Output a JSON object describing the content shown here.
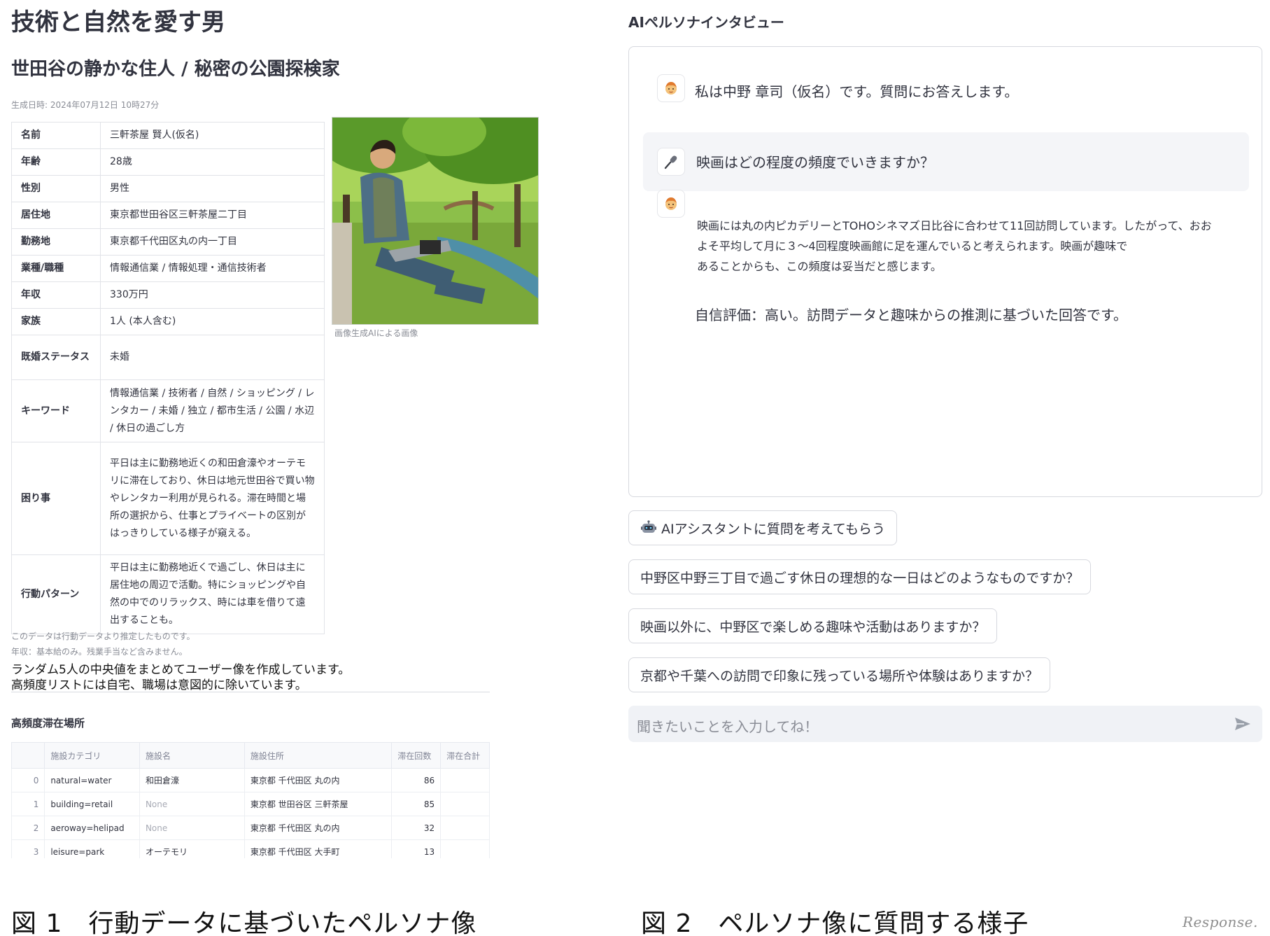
{
  "persona": {
    "title": "技術と自然を愛す男",
    "subtitle": "世田谷の静かな住人 / 秘密の公園探検家",
    "generated_at": "生成日時: 2024年07月12日 10時27分",
    "profile_rows": [
      {
        "key": "名前",
        "value": "三軒茶屋 賢人(仮名)"
      },
      {
        "key": "年齢",
        "value": "28歳"
      },
      {
        "key": "性別",
        "value": "男性"
      },
      {
        "key": "居住地",
        "value": "東京都世田谷区三軒茶屋二丁目"
      },
      {
        "key": "勤務地",
        "value": "東京都千代田区丸の内一丁目"
      },
      {
        "key": "業種/職種",
        "value": "情報通信業 / 情報処理・通信技術者"
      },
      {
        "key": "年収",
        "value": "330万円"
      },
      {
        "key": "家族",
        "value": "1人 (本人含む)"
      },
      {
        "key": "既婚ステータス",
        "value": "未婚"
      },
      {
        "key": "キーワード",
        "value": "情報通信業 / 技術者 / 自然 / ショッピング / レンタカー / 未婚 / 独立 / 都市生活 / 公園 / 水辺 / 休日の過ごし方"
      },
      {
        "key": "困り事",
        "value": "平日は主に勤務地近くの和田倉濠やオーテモリに滞在しており、休日は地元世田谷で買い物やレンタカー利用が見られる。滞在時間と場所の選択から、仕事とプライベートの区別がはっきりしている様子が窺える。"
      },
      {
        "key": "行動パターン",
        "value": "平日は主に勤務地近くで過ごし、休日は主に居住地の周辺で活動。特にショッピングや自然の中でのリラックス、時には車を借りて遠出することも。"
      }
    ],
    "image_caption": "画像生成AIによる画像",
    "note_estimated": "このデータは行動データより推定したものです。",
    "note_income": "年収：基本給のみ。残業手当など含みません。",
    "body_line1": "ランダム5人の中央値をまとめてユーザー像を作成しています。",
    "body_line2": "高頻度リストには自宅、職場は意図的に除いています。",
    "places_heading": "高頻度滞在場所",
    "places_table": {
      "columns": [
        "",
        "施設カテゴリ",
        "施設名",
        "施設住所",
        "滞在回数",
        "滞在合計"
      ],
      "rows": [
        {
          "idx": "0",
          "category": "natural=water",
          "name": "和田倉濠",
          "address": "東京都 千代田区 丸の内",
          "count": "86",
          "total": ""
        },
        {
          "idx": "1",
          "category": "building=retail",
          "name": "None",
          "address": "東京都 世田谷区 三軒茶屋",
          "count": "85",
          "total": ""
        },
        {
          "idx": "2",
          "category": "aeroway=helipad",
          "name": "None",
          "address": "東京都 千代田区 丸の内",
          "count": "32",
          "total": ""
        },
        {
          "idx": "3",
          "category": "leisure=park",
          "name": "オーテモリ",
          "address": "東京都 千代田区 大手町",
          "count": "13",
          "total": ""
        }
      ]
    },
    "figure_caption": "図 1　行動データに基づいたペルソナ像"
  },
  "interview": {
    "title": "AIペルソナインタビュー",
    "greeting": "私は中野 章司（仮名）です。質問にお答えします。",
    "user_question": "映画はどの程度の頻度でいきますか？",
    "answer_lines": [
      "映画には丸の内ピカデリーとTOHOシネマズ日比谷に合わせて11回訪問しています。したがって、おお",
      "よそ平均して月に３～4回程度映画館に足を運んでいると考えられます。映画が趣味で",
      "あることからも、この頻度は妥当だと感じます。"
    ],
    "confidence": "自信評価：高い。訪問データと趣味からの推測に基づいた回答です。",
    "assistant_button": "AIアシスタントに質問を考えてもらう",
    "suggestions": [
      "中野区中野三丁目で過ごす休日の理想的な一日はどのようなものですか？",
      "映画以外に、中野区で楽しめる趣味や活動はありますか？",
      "京都や千葉への訪問で印象に残っている場所や体験はありますか？"
    ],
    "input_placeholder": "聞きたいことを入力してね！",
    "figure_caption": "図 2　ペルソナ像に質問する様子"
  },
  "watermark": "Response.",
  "icons": {
    "persona_avatar": "person-face-icon",
    "user_avatar": "microphone-icon",
    "assistant_button": "robot-icon",
    "send": "send-arrow-icon"
  }
}
